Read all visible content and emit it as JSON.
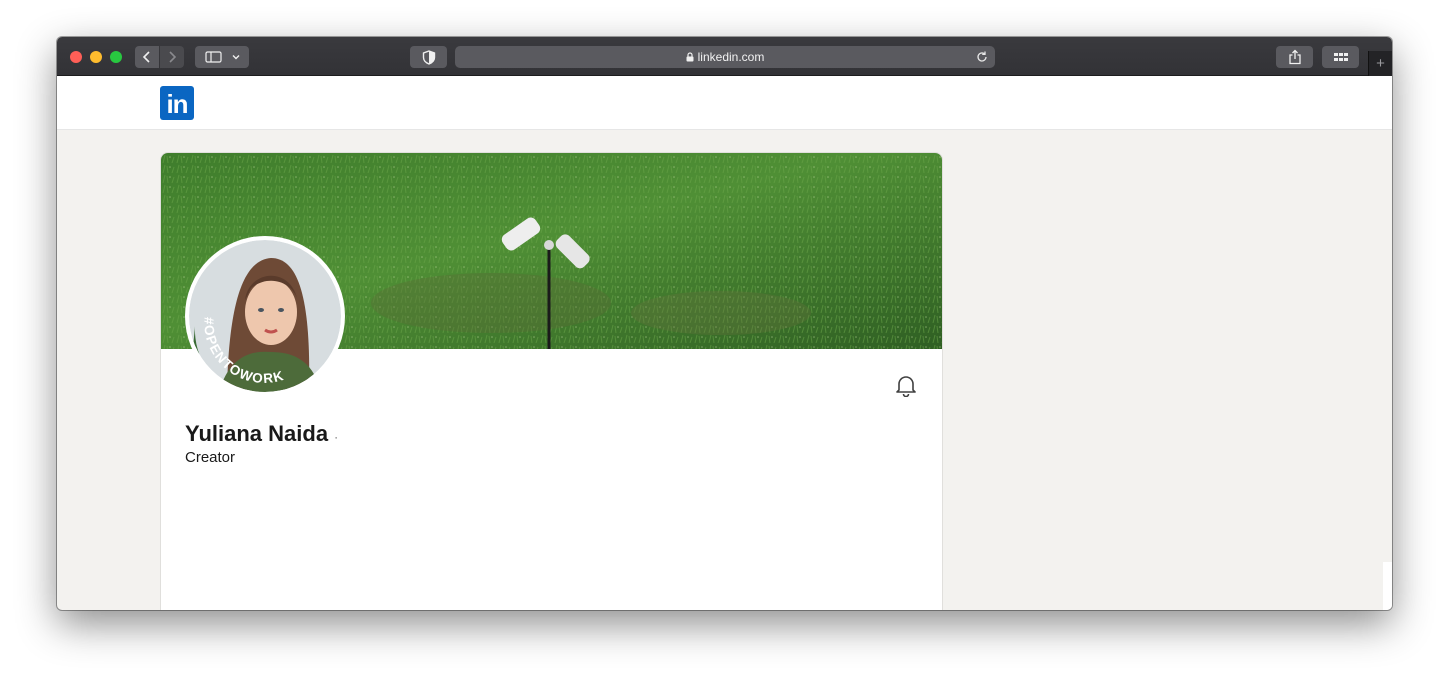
{
  "browser": {
    "url": "linkedin.com",
    "new_tab_symbol": "+"
  },
  "site": {
    "logo_text": "in",
    "brand_color": "#0a66c2"
  },
  "profile": {
    "name": "Yuliana Naida",
    "separator": "·",
    "headline": "Creator",
    "open_to_work_badge": "#OPENTOWORK",
    "badge_color": "#3a6b35"
  },
  "icons": {
    "back": "chevron-left-icon",
    "forward": "chevron-right-icon",
    "sidebar": "sidebar-icon",
    "shield": "privacy-shield-icon",
    "lock": "lock-icon",
    "reload": "reload-icon",
    "share": "share-icon",
    "tabs": "tab-overview-icon",
    "bell": "bell-icon"
  }
}
